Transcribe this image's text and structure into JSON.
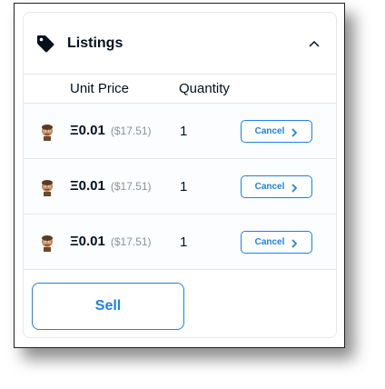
{
  "listings": {
    "title": "Listings",
    "title_icon": "tag-icon",
    "collapse_icon": "chevron-up-icon",
    "columns": {
      "unit_price": "Unit Price",
      "quantity": "Quantity"
    },
    "rows": [
      {
        "eth_price": "Ξ0.01",
        "usd_price": "($17.51)",
        "quantity": "1",
        "action": "Cancel"
      },
      {
        "eth_price": "Ξ0.01",
        "usd_price": "($17.51)",
        "quantity": "1",
        "action": "Cancel"
      },
      {
        "eth_price": "Ξ0.01",
        "usd_price": "($17.51)",
        "quantity": "1",
        "action": "Cancel"
      }
    ],
    "sell_label": "Sell"
  },
  "colors": {
    "accent": "#2081e2",
    "text": "#04111d",
    "muted": "#8a939b",
    "border": "#e5e8eb"
  }
}
